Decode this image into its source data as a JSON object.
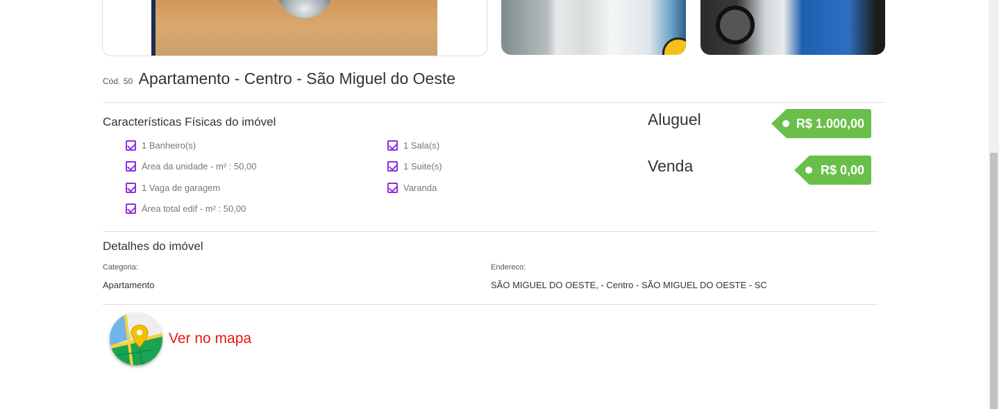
{
  "listing": {
    "code_label": "Cód.",
    "code_value": "50",
    "title": "Apartamento - Centro - São Miguel do Oeste"
  },
  "features": {
    "title": "Características Físicas do imóvel",
    "left": [
      "1 Banheiro(s)",
      "Área da unidade - m² : 50,00",
      "1 Vaga de garagem",
      "Área total edif - m² : 50,00"
    ],
    "right": [
      "1 Sala(s)",
      "1 Suite(s)",
      "Varanda"
    ]
  },
  "prices": {
    "rent_label": "Aluguel",
    "rent_value": "R$ 1.000,00",
    "sale_label": "Venda",
    "sale_value": "R$ 0,00"
  },
  "details": {
    "title": "Detalhes do imóvel",
    "category_label": "Categoria:",
    "category_value": "Apartamento",
    "address_label": "Endereco:",
    "address_value": "SÃO MIGUEL DO OESTE, - Centro - SÃO MIGUEL DO OESTE - SC"
  },
  "map": {
    "link_label": "Ver no mapa",
    "icon": "map-pin-icon"
  },
  "colors": {
    "check": "#8e2de2",
    "price_tag": "#6abf4b",
    "map_link": "#e8180c"
  }
}
